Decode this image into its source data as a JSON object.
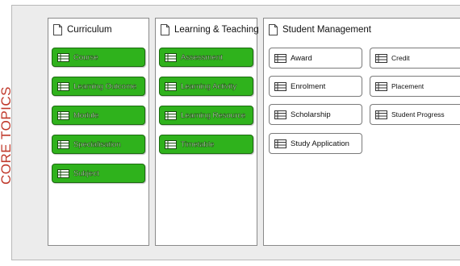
{
  "side_label": "CORE TOPICS",
  "colors": {
    "side_label": "#c0392b",
    "green_fill": "#2fb21c",
    "green_border": "#1c6a10"
  },
  "icons": {
    "panel_header": "document-icon",
    "item": "table-icon"
  },
  "panels": {
    "curriculum": {
      "title": "Curriculum",
      "items": [
        "Course",
        "Learning Outcome",
        "Module",
        "Specialisation",
        "Subject"
      ]
    },
    "learning_teaching": {
      "title": "Learning & Teaching",
      "items": [
        "Assessment",
        "Learning Activity",
        "Learning Resource",
        "Timetable"
      ]
    },
    "student_management": {
      "title": "Student Management",
      "items_left": [
        "Award",
        "Enrolment",
        "Scholarship",
        "Study Application"
      ],
      "items_right": [
        "Credit",
        "Placement",
        "Student Progress"
      ]
    }
  }
}
